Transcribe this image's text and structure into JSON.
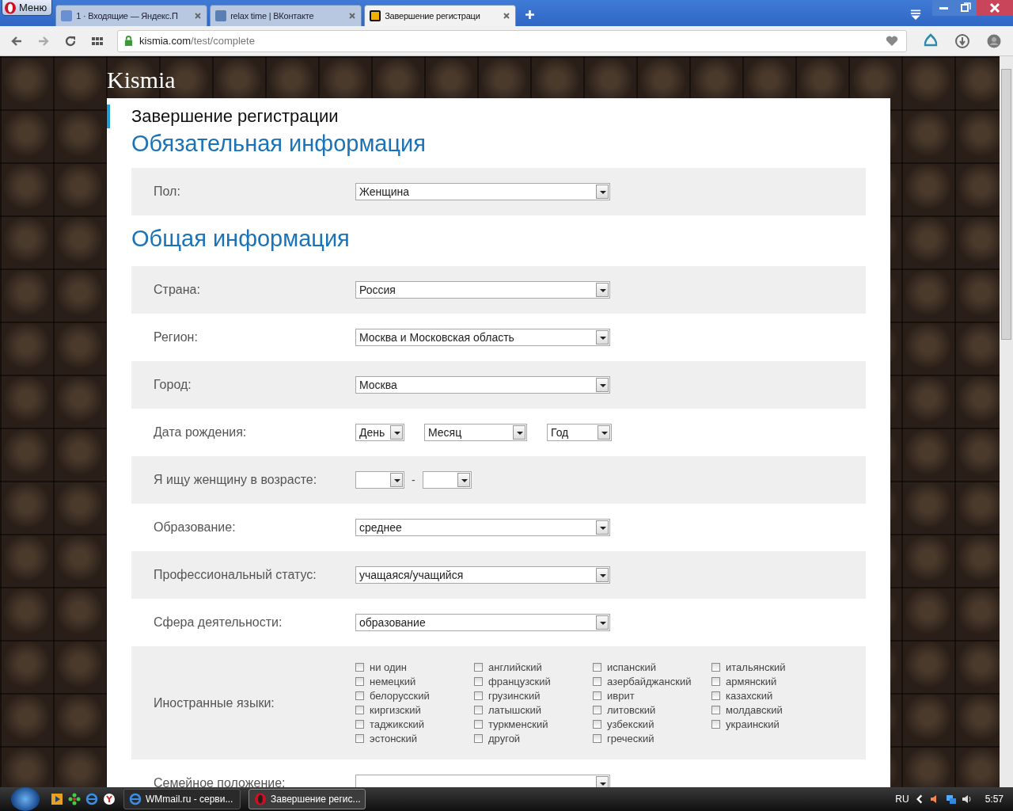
{
  "browser": {
    "menu_label": "Меню",
    "tabs": [
      {
        "title": "1 · Входящие — Яндекс.П",
        "kind": "mail",
        "selected": false
      },
      {
        "title": "relax time | ВКонтакте",
        "kind": "vk",
        "selected": false
      },
      {
        "title": "Завершение регистраци",
        "kind": "k",
        "selected": true
      }
    ],
    "url": {
      "domain": "kismia.com",
      "path": "/test/complete"
    }
  },
  "site": {
    "logo": "Kismia",
    "page_title": "Завершение регистрации",
    "sections": [
      {
        "heading": "Обязательная информация",
        "rows": [
          {
            "kind": "select",
            "label": "Пол:",
            "value": "Женщина"
          }
        ]
      },
      {
        "heading": "Общая информация",
        "rows": [
          {
            "kind": "select",
            "label": "Страна:",
            "value": "Россия"
          },
          {
            "kind": "select",
            "label": "Регион:",
            "value": "Москва и Московская область"
          },
          {
            "kind": "select",
            "label": "Город:",
            "value": "Москва"
          },
          {
            "kind": "date",
            "label": "Дата рождения:",
            "parts": [
              "День",
              "Месяц",
              "Год"
            ]
          },
          {
            "kind": "range",
            "label": "Я ищу женщину в возрасте:",
            "separator": "-"
          },
          {
            "kind": "select",
            "label": "Образование:",
            "value": "среднее"
          },
          {
            "kind": "select",
            "label": "Профессиональный статус:",
            "value": "учащаяся/учащийся"
          },
          {
            "kind": "select",
            "label": "Сфера деятельности:",
            "value": "образование"
          },
          {
            "kind": "checkboxes",
            "label": "Иностранные языки:",
            "options": [
              {
                "label": "ни один",
                "checked": false
              },
              {
                "label": "английский",
                "checked": false
              },
              {
                "label": "испанский",
                "checked": false
              },
              {
                "label": "итальянский",
                "checked": false
              },
              {
                "label": "немецкий",
                "checked": false
              },
              {
                "label": "французский",
                "checked": false
              },
              {
                "label": "азербайджанский",
                "checked": false
              },
              {
                "label": "армянский",
                "checked": false
              },
              {
                "label": "белорусский",
                "checked": false
              },
              {
                "label": "грузинский",
                "checked": false
              },
              {
                "label": "иврит",
                "checked": false
              },
              {
                "label": "казахский",
                "checked": false
              },
              {
                "label": "киргизский",
                "checked": false
              },
              {
                "label": "латышский",
                "checked": false
              },
              {
                "label": "литовский",
                "checked": false
              },
              {
                "label": "молдавский",
                "checked": false
              },
              {
                "label": "таджикский",
                "checked": false
              },
              {
                "label": "туркменский",
                "checked": false
              },
              {
                "label": "узбекский",
                "checked": false
              },
              {
                "label": "украинский",
                "checked": false
              },
              {
                "label": "эстонский",
                "checked": false
              },
              {
                "label": "другой",
                "checked": false
              },
              {
                "label": "греческий",
                "checked": false
              }
            ]
          },
          {
            "kind": "select",
            "label": "Семейное положение:",
            "value": ""
          }
        ]
      }
    ]
  },
  "taskbar": {
    "apps": [
      {
        "title": "WMmail.ru - серви...",
        "kind": "ie",
        "selected": false
      },
      {
        "title": "Завершение регис...",
        "kind": "opera",
        "selected": true
      }
    ],
    "language": "RU",
    "time": "5:57"
  }
}
